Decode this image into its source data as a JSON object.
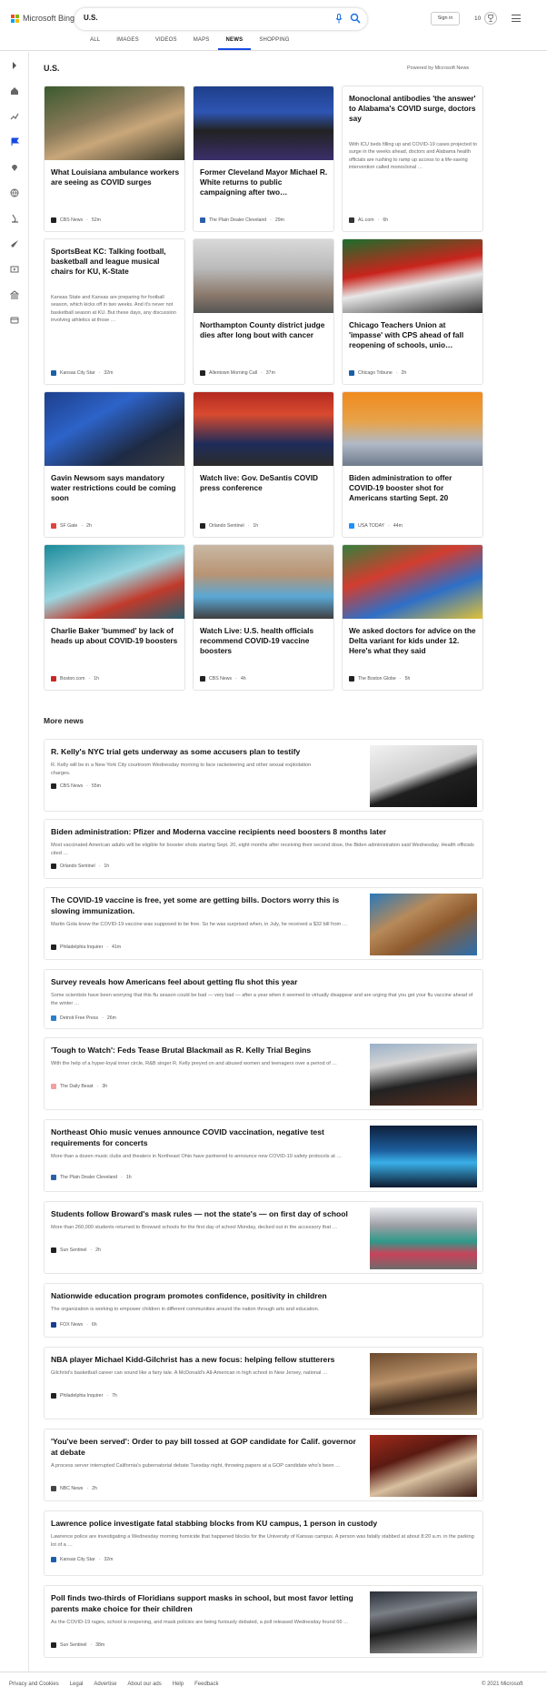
{
  "header": {
    "brand": "Microsoft Bing",
    "query": "U.S.",
    "sign_in": "Sign in",
    "rewards_count": "10",
    "tabs": [
      {
        "label": "ALL"
      },
      {
        "label": "IMAGES"
      },
      {
        "label": "VIDEOS"
      },
      {
        "label": "MAPS"
      },
      {
        "label": "NEWS"
      },
      {
        "label": "SHOPPING"
      }
    ]
  },
  "section": {
    "title": "U.S.",
    "powered": "Powered by Microsoft News"
  },
  "cards": [
    {
      "title": "What Louisiana ambulance workers are seeing as COVID surges",
      "source": "CBS News",
      "age": "52m",
      "color": "#222"
    },
    {
      "title": "Former Cleveland Mayor Michael R. White returns to public campaigning after two…",
      "source": "The Plain Dealer Cleveland",
      "age": "29m",
      "color": "#2b5fa8"
    },
    {
      "title": "Monoclonal antibodies 'the answer' to Alabama's COVID surge, doctors say",
      "desc": "With ICU beds filling up and COVID-19 cases projected to surge in the weeks ahead, doctors and Alabama health officials are rushing to ramp up access to a life-saving intervention called monoclonal …",
      "source": "AL.com",
      "age": "6h",
      "color": "#333"
    },
    {
      "title": "SportsBeat KC: Talking football, basketball and league musical chairs for KU, K-State",
      "desc": "Kansas State and Kansas are preparing for football season, which kicks off in two weeks. And it's never not basketball season at KU. But these days, any discussion involving athletics at those …",
      "source": "Kansas City Star",
      "age": "32m",
      "color": "#1a5fa8"
    },
    {
      "title": "Northampton County district judge dies after long bout with cancer",
      "source": "Allentown Morning Call",
      "age": "37m",
      "color": "#222"
    },
    {
      "title": "Chicago Teachers Union at 'impasse' with CPS ahead of fall reopening of schools, unio…",
      "source": "Chicago Tribune",
      "age": "2h",
      "color": "#1a5fa8"
    },
    {
      "title": "Gavin Newsom says mandatory water restrictions could be coming soon",
      "source": "SF Gate",
      "age": "2h",
      "color": "#e0433b"
    },
    {
      "title": "Watch live: Gov. DeSantis COVID press conference",
      "source": "Orlando Sentinel",
      "age": "1h",
      "color": "#222"
    },
    {
      "title": "Biden administration to offer COVID-19 booster shot for Americans starting Sept. 20",
      "source": "USA TODAY",
      "age": "44m",
      "color": "#1e90ff"
    },
    {
      "title": "Charlie Baker 'bummed' by lack of heads up about COVID-19 boosters",
      "source": "Boston.com",
      "age": "1h",
      "color": "#c62828"
    },
    {
      "title": "Watch Live: U.S. health officials recommend COVID-19 vaccine boosters",
      "source": "CBS News",
      "age": "4h",
      "color": "#222"
    },
    {
      "title": "We asked doctors for advice on the Delta variant for kids under 12. Here's what they said",
      "source": "The Boston Globe",
      "age": "5h",
      "color": "#222"
    }
  ],
  "more_news": {
    "title": "More news",
    "items": [
      {
        "title": "R. Kelly's NYC trial gets underway as some accusers plan to testify",
        "desc": "R. Kelly will be in a New York City courtroom Wednesday morning to face racketeering and other sexual exploitation charges.",
        "source": "CBS News",
        "age": "55m",
        "color": "#222"
      },
      {
        "title": "Biden administration: Pfizer and Moderna vaccine recipients need boosters 8 months later",
        "desc": "Most vaccinated American adults will be eligible for booster shots starting Sept. 20, eight months after receiving their second dose, the Biden administration said Wednesday. Health officials cited …",
        "source": "Orlando Sentinel",
        "age": "1h",
        "color": "#222"
      },
      {
        "title": "The COVID-19 vaccine is free, yet some are getting bills. Doctors worry this is slowing immunization.",
        "desc": "Martin Gola knew the COVID-19 vaccine was supposed to be free. So he was surprised when, in July, he received a $32 bill from …",
        "source": "Philadelphia Inquirer",
        "age": "41m",
        "color": "#222"
      },
      {
        "title": "Survey reveals how Americans feel about getting flu shot this year",
        "desc": "Some scientists have been worrying that this flu season could be bad — very bad — after a year when it seemed to virtually disappear and are urging that you get your flu vaccine ahead of the winter …",
        "source": "Detroit Free Press",
        "age": "26m",
        "color": "#2a7fc9"
      },
      {
        "title": "'Tough to Watch': Feds Tease Brutal Blackmail as R. Kelly Trial Begins",
        "desc": "With the help of a hyper-loyal inner circle, R&B singer R. Kelly preyed on and abused women and teenagers over a period of …",
        "source": "The Daily Beast",
        "age": "3h",
        "color": "#f2a0a0"
      },
      {
        "title": "Northeast Ohio music venues announce COVID vaccination, negative test requirements for concerts",
        "desc": "More than a dozen music clubs and theaters in Northeast Ohio have partnered to announce new COVID-19 safety protocols at …",
        "source": "The Plain Dealer Cleveland",
        "age": "1h",
        "color": "#2b5fa8"
      },
      {
        "title": "Students follow Broward's mask rules — not the state's — on first day of school",
        "desc": "More than 260,000 students returned to Broward schools for the first day of school Monday, decked out in the accessory that …",
        "source": "Sun Sentinel",
        "age": "2h",
        "color": "#222"
      },
      {
        "title": "Nationwide education program promotes confidence, positivity in children",
        "desc": "The organization is working to empower children in different communities around the nation through arts and education.",
        "source": "FOX News",
        "age": "6h",
        "color": "#1a3d8f"
      },
      {
        "title": "NBA player Michael Kidd-Gilchrist has a new focus: helping fellow stutterers",
        "desc": "Gilchrist's basketball career can sound like a fairy tale. A McDonald's All-American in high school in New Jersey, national …",
        "source": "Philadelphia Inquirer",
        "age": "7h",
        "color": "#222"
      },
      {
        "title": "'You've been served': Order to pay bill tossed at GOP candidate for Calif. governor at debate",
        "desc": "A process server interrupted California's gubernatorial debate Tuesday night, throwing papers at a GOP candidate who's been …",
        "source": "NBC News",
        "age": "2h",
        "color": "#444"
      },
      {
        "title": "Lawrence police investigate fatal stabbing blocks from KU campus, 1 person in custody",
        "desc": "Lawrence police are investigating a Wednesday morning homicide that happened blocks for the University of Kansas campus. A person was fatally stabbed at about 8:20 a.m. in the parking lot of a …",
        "source": "Kansas City Star",
        "age": "32m",
        "color": "#1a5fa8"
      },
      {
        "title": "Poll finds two-thirds of Floridians support masks in school, but most favor letting parents make choice for their children",
        "desc": "As the COVID-19 rages, school is reopening, and mask policies are being furiously debated, a poll released Wednesday found 66 …",
        "source": "Sun Sentinel",
        "age": "38m",
        "color": "#222"
      }
    ]
  },
  "footer": {
    "links": [
      "Privacy and Cookies",
      "Legal",
      "Advertise",
      "About our ads",
      "Help",
      "Feedback"
    ],
    "copyright": "© 2021 Microsoft"
  }
}
